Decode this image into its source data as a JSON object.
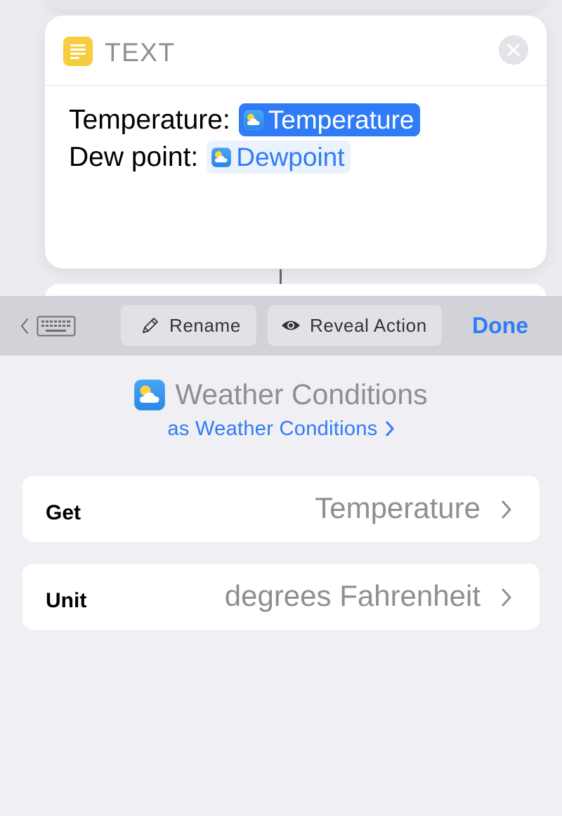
{
  "text_action": {
    "title": "TEXT",
    "line1_label": "Temperature:",
    "line1_token": "Temperature",
    "line2_label": "Dew point:",
    "line2_token": "Dewpoint"
  },
  "toolbar": {
    "rename_label": "Rename",
    "reveal_label": "Reveal Action",
    "done_label": "Done"
  },
  "variable": {
    "name": "Weather Conditions",
    "subtitle": "as Weather Conditions"
  },
  "params": {
    "get_label": "Get",
    "get_value": "Temperature",
    "unit_label": "Unit",
    "unit_value": "degrees Fahrenheit"
  },
  "colors": {
    "accent": "#2f7cf6",
    "text_icon": "#f6cd3f",
    "toolbar": "#d2d3d8",
    "background": "#efeff4"
  },
  "icons": [
    "text-action-icon",
    "close-icon",
    "weather-icon",
    "keyboard-icon",
    "chevron-left-icon",
    "pencil-icon",
    "eye-icon",
    "chevron-right-icon"
  ]
}
